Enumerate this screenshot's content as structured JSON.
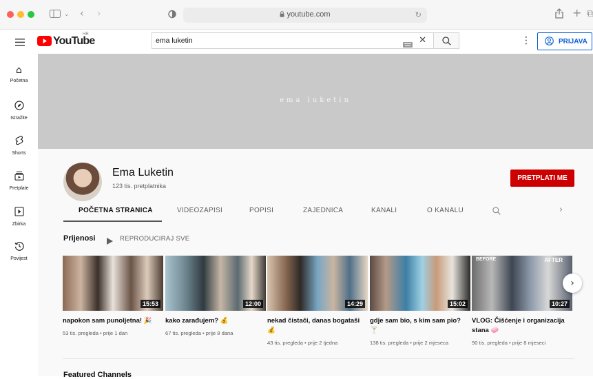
{
  "browser": {
    "url": "youtube.com"
  },
  "header": {
    "logo_text": "YouTube",
    "region": "HR",
    "search_value": "ema luketin",
    "sign_in_label": "PRIJAVA"
  },
  "sidebar": {
    "items": [
      {
        "label": "Početna"
      },
      {
        "label": "Istražite"
      },
      {
        "label": "Shorts"
      },
      {
        "label": "Pretplate"
      },
      {
        "label": "Zbirka"
      },
      {
        "label": "Povijest"
      }
    ]
  },
  "banner": {
    "text": "ema luketin"
  },
  "channel": {
    "name": "Ema Luketin",
    "subscribers": "123 tis. pretplatnika",
    "subscribe_label": "PRETPLATI ME",
    "tabs": [
      {
        "label": "POČETNA STRANICA"
      },
      {
        "label": "VIDEOZAPISI"
      },
      {
        "label": "POPISI"
      },
      {
        "label": "ZAJEDNICA"
      },
      {
        "label": "KANALI"
      },
      {
        "label": "O KANALU"
      }
    ]
  },
  "section": {
    "title": "Prijenosi",
    "play_all": "REPRODUCIRAJ SVE",
    "next_title": "Featured Channels"
  },
  "videos": [
    {
      "title": "napokon sam punoljetna! 🎉",
      "meta": "53 tis. pregleda • prije 1 dan",
      "duration": "15:53"
    },
    {
      "title": "kako zarađujem? 💰",
      "meta": "67 tis. pregleda • prije 8 dana",
      "duration": "12:00"
    },
    {
      "title": "nekad čistači, danas bogataši 💰",
      "meta": "43 tis. pregleda • prije 2 tjedna",
      "duration": "14:29"
    },
    {
      "title": "gdje sam bio, s kim sam pio? 🍸",
      "meta": "138 tis. pregleda • prije 2 mjeseca",
      "duration": "15:02"
    },
    {
      "title": "VLOG: Čišćenje i organizacija stana 🧼",
      "meta": "90 tis. pregleda • prije 8 mjeseci",
      "duration": "10:27",
      "overlay_before": "BEFORE",
      "overlay_after": "AFTER"
    }
  ]
}
